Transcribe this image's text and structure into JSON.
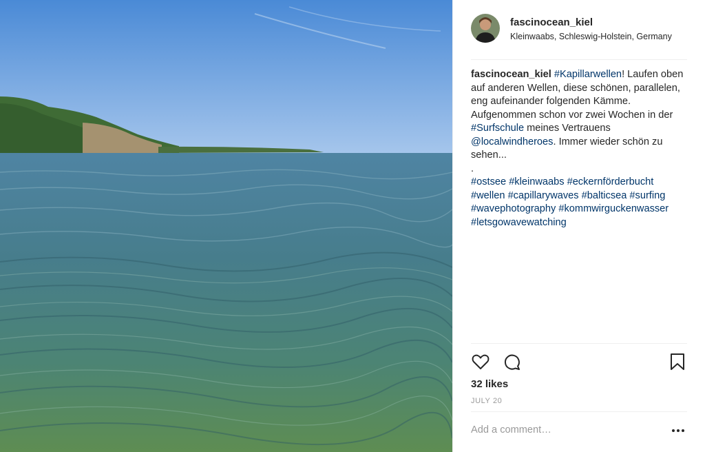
{
  "colors": {
    "accent_link": "#003569",
    "text": "#262626",
    "muted": "#999999",
    "border": "#efefef"
  },
  "post": {
    "image_alt": "Baltic sea waves near Kleinwaabs",
    "author": {
      "username": "fascinocean_kiel",
      "location": "Kleinwaabs, Schleswig-Holstein, Germany"
    },
    "caption": {
      "username": "fascinocean_kiel",
      "parts": [
        {
          "text": "#Kapillarwellen",
          "tag": true
        },
        {
          "text": "! Laufen oben auf anderen Wellen, diese schönen, parallelen, eng aufeinander folgenden Kämme. Aufgenommen schon vor zwei Wochen in der ",
          "tag": false
        },
        {
          "text": "#Surfschule",
          "tag": true
        },
        {
          "text": " meines Vertrauens ",
          "tag": false
        },
        {
          "text": "@localwindheroes",
          "tag": true
        },
        {
          "text": ". Immer wieder schön zu sehen...",
          "tag": false
        }
      ],
      "separator": ".",
      "hashtags": [
        "#ostsee",
        "#kleinwaabs",
        "#eckernförderbucht",
        "#wellen",
        "#capillarywaves",
        "#balticsea",
        "#surfing",
        "#wavephotography",
        "#kommwirguckenwasser",
        "#letsgowavewatching"
      ]
    },
    "icons": {
      "like": "heart-icon",
      "comment": "comment-icon",
      "save": "bookmark-icon",
      "more": "more-options-icon"
    },
    "likes": "32 likes",
    "date": "JULY 20",
    "comment_placeholder": "Add a comment…"
  }
}
